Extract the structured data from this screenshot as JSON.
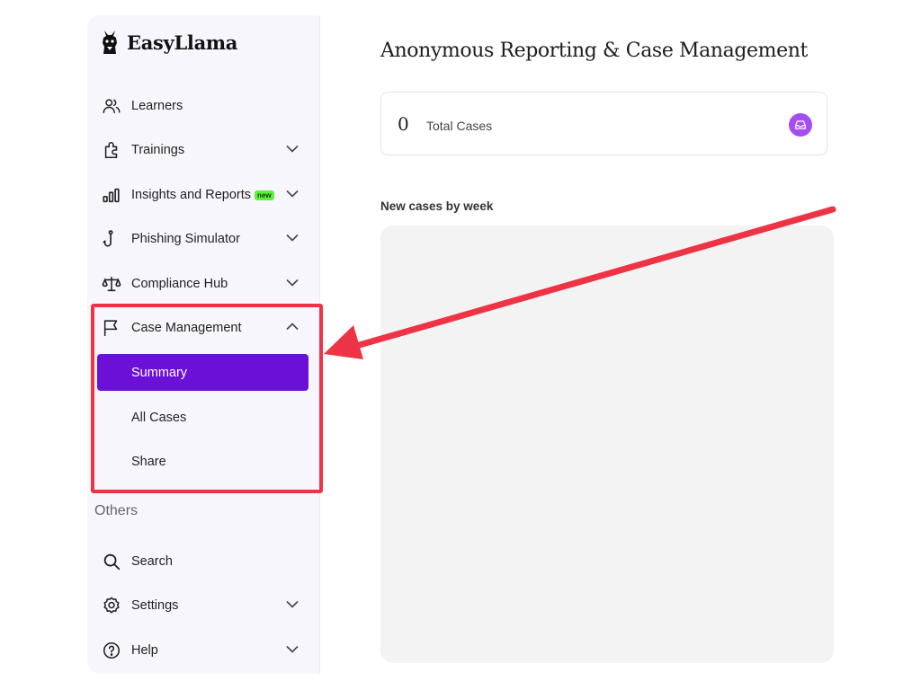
{
  "app": {
    "name": "EasyLlama"
  },
  "sidebar": {
    "items": [
      {
        "label": "Learners",
        "icon": "users-icon",
        "expandable": false
      },
      {
        "label": "Trainings",
        "icon": "puzzle-icon",
        "expandable": true
      },
      {
        "label": "Insights and Reports",
        "icon": "bar-chart-icon",
        "expandable": true,
        "badge": "new"
      },
      {
        "label": "Phishing Simulator",
        "icon": "hook-icon",
        "expandable": true
      },
      {
        "label": "Compliance Hub",
        "icon": "scale-icon",
        "expandable": true
      },
      {
        "label": "Case Management",
        "icon": "flag-icon",
        "expandable": true,
        "expanded": true
      }
    ],
    "case_management_subitems": [
      {
        "label": "Summary",
        "active": true
      },
      {
        "label": "All Cases",
        "active": false
      },
      {
        "label": "Share",
        "active": false
      }
    ],
    "others_label": "Others",
    "others_items": [
      {
        "label": "Search",
        "icon": "search-icon",
        "expandable": false
      },
      {
        "label": "Settings",
        "icon": "gear-icon",
        "expandable": true
      },
      {
        "label": "Help",
        "icon": "help-icon",
        "expandable": true
      }
    ]
  },
  "main": {
    "title": "Anonymous Reporting & Case Management",
    "stat": {
      "value": "0",
      "label": "Total Cases",
      "icon": "inbox-icon"
    },
    "chart_title": "New cases by week"
  },
  "colors": {
    "accent": "#6b10d6",
    "badge": "#5ef03a",
    "annotation": "#ee3344",
    "sidebar_bg": "#f8f6fd"
  }
}
